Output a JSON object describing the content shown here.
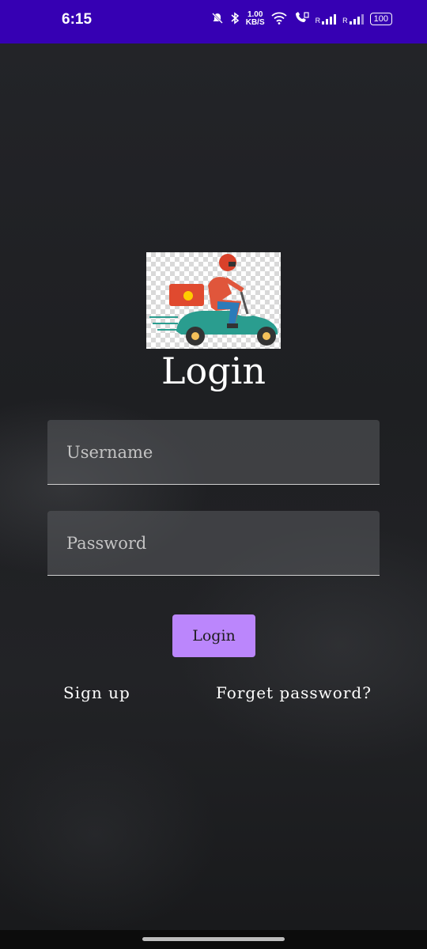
{
  "status_bar": {
    "time": "6:15",
    "net_speed_value": "1.00",
    "net_speed_unit": "KB/S",
    "signal_1_label": "R",
    "signal_2_label": "R",
    "battery": "100"
  },
  "screen": {
    "title": "Login",
    "username": {
      "placeholder": "Username",
      "value": ""
    },
    "password": {
      "placeholder": "Password",
      "value": ""
    },
    "login_button": "Login",
    "sign_up_link": "Sign up",
    "forget_password_link": "Forget password?"
  },
  "colors": {
    "status_bar": "#3600b3",
    "button": "#bb86fc",
    "background": "#1f2023"
  },
  "icons": [
    "mute-bell-icon",
    "bluetooth-icon",
    "wifi-icon",
    "volte-call-icon",
    "signal-icon",
    "battery-icon",
    "delivery-scooter-logo"
  ]
}
